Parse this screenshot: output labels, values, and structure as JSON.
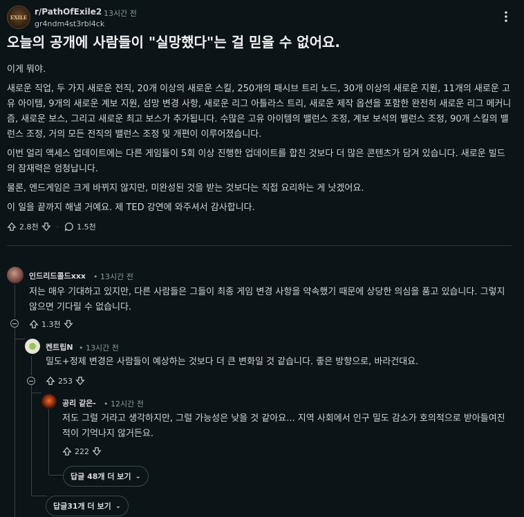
{
  "post": {
    "subreddit": "r/PathOfExile2",
    "time": "• 13시간 전",
    "author": "gr4ndm4st3rbl4ck",
    "title": "오늘의 공개에 사람들이 \"실망했다\"는 걸 믿을 수 없어요.",
    "paragraphs": [
      "이게 뭐야.",
      "새로운 직업, 두 가지 새로운 전직, 20개 이상의 새로운 스킬, 250개의 패시브 트리 노드, 30개 이상의 새로운 지원, 11개의 새로운 고유 아이템, 9개의 새로운 계보 지원, 섬망 변경 사항, 새로운 리그 아틀라스 트리, 새로운 제작 옵션을 포함한 완전히 새로운 리그 메커니즘, 새로운 보스, 그리고 새로운 최고 보스가 추가됩니다. 수많은 고유 아이템의 밸런스 조정, 계보 보석의 밸런스 조정, 90개 스킬의 밸런스 조정, 거의 모든 전직의 밸런스 조정 및 개편이 이루어졌습니다.",
      "이번 얼리 액세스 업데이트에는 다른 게임들이 5회 이상 진행한 업데이트를 합친 것보다 더 많은 콘텐츠가 담겨 있습니다. 새로운 빌드의 잠재력은 엄청납니다.",
      "물론, 엔드게임은 크게 바뀌지 않지만, 미완성된 것을 받는 것보다는 직접 요리하는 게 낫겠어요.",
      "이 일을 끝까지 해낼 거예요. 제 TED 강연에 와주셔서 감사합니다."
    ],
    "upvotes": "2.8천",
    "comments_count": "1.5천"
  },
  "comments": [
    {
      "author": "인드리드콜드xxx",
      "time": "• 13시간 전",
      "text": "저는 매우 기대하고 있지만, 다른 사람들은 그들이 최종 게임 변경 사항을 약속했기 때문에 상당한 의심을 품고 있습니다. 그렇지 않으면 기다릴 수 없습니다.",
      "votes": "1.3천"
    },
    {
      "author": "켄트립N",
      "time": "• 13시간 전",
      "text": "밀도+정제 변경은 사람들이 예상하는 것보다 더 큰 변화일 것 같습니다. 좋은 방향으로, 바라건대요.",
      "votes": "253"
    },
    {
      "author": "공리 같은-",
      "time": "• 12시간 전",
      "text": "저도 그럴 거라고 생각하지만, 그럴 가능성은 낮을 것 같아요... 지역 사회에서 인구 밀도 감소가 호의적으로 받아들여진 적이 기억나지 않거든요.",
      "votes": "222"
    }
  ],
  "more_replies": [
    "답글 48개 더 보기",
    "답글31개 더 보기"
  ],
  "colors": {
    "background": "#0b1416",
    "text": "#d7dadc",
    "muted": "#8d9ba1",
    "line": "#3a454b"
  }
}
